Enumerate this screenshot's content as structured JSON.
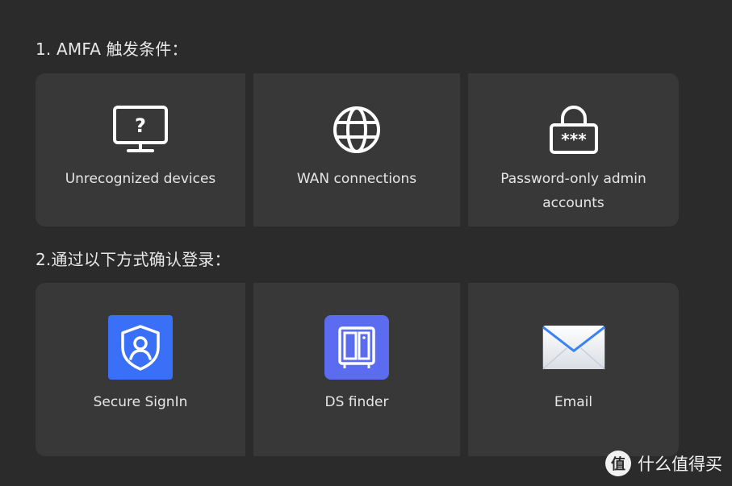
{
  "section1": {
    "title": "1. AMFA 触发条件："
  },
  "conditions": [
    {
      "label": "Unrecognized devices",
      "icon": "monitor-question-icon"
    },
    {
      "label": "WAN connections",
      "icon": "globe-icon"
    },
    {
      "label": "Password-only admin accounts",
      "icon": "lock-password-icon"
    }
  ],
  "section2": {
    "title": "2.通过以下方式确认登录："
  },
  "methods": [
    {
      "label": "Secure SignIn",
      "icon": "secure-signin-shield-icon",
      "color": "#3a6ff7"
    },
    {
      "label": "DS finder",
      "icon": "ds-finder-icon",
      "color": "#5b6cf0"
    },
    {
      "label": "Email",
      "icon": "envelope-icon"
    }
  ],
  "watermark": {
    "text": "什么值得买",
    "logo_glyph": "值"
  }
}
